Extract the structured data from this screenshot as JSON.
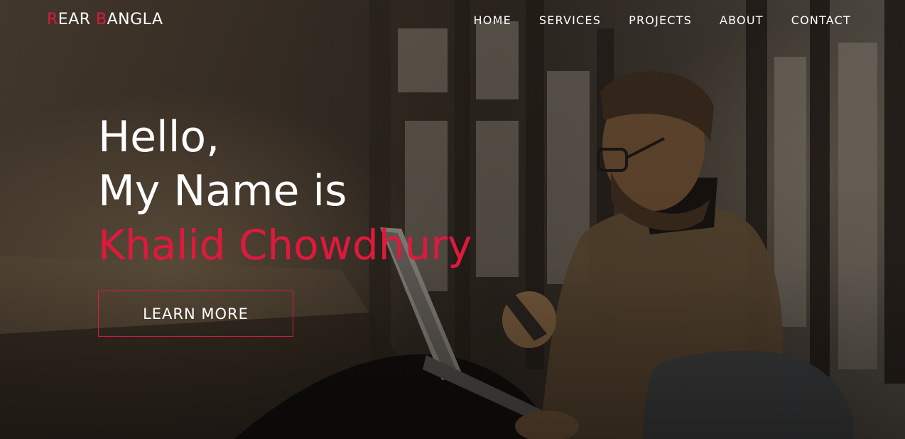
{
  "brand": {
    "logo_r": "R",
    "logo_ear": "EAR ",
    "logo_b": "B",
    "logo_angla": "ANGLA",
    "accent_color": "#e0193c"
  },
  "nav": {
    "items": [
      {
        "label": "HOME"
      },
      {
        "label": "SERVICES"
      },
      {
        "label": "PROJECTS"
      },
      {
        "label": "ABOUT"
      },
      {
        "label": "CONTACT"
      }
    ]
  },
  "hero": {
    "line1": "Hello,",
    "line2": "My Name is",
    "name": "Khalid Chowdhury",
    "button_label": "LEARN MORE",
    "background_image": "man-with-laptop-and-phone-photo"
  }
}
